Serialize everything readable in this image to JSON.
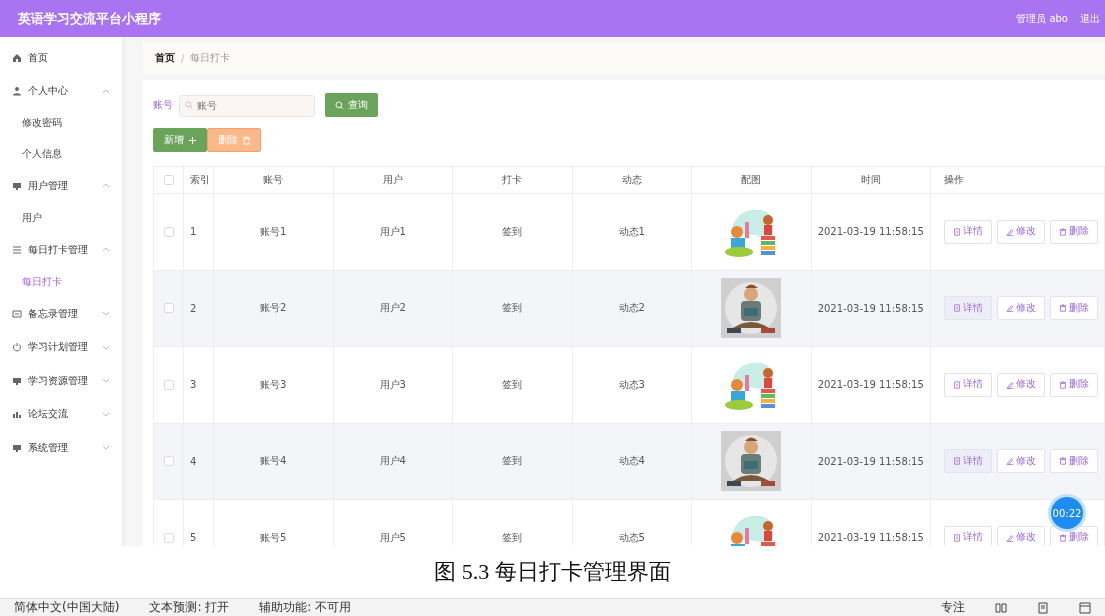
{
  "app": {
    "title": "英语学习交流平台小程序",
    "user": "管理员 abo",
    "logout": "退出"
  },
  "sidebar": {
    "items": [
      {
        "label": "首页"
      },
      {
        "label": "个人中心",
        "expanded": true,
        "children": [
          {
            "label": "修改密码",
            "selected": false
          },
          {
            "label": "个人信息",
            "selected": false
          }
        ]
      },
      {
        "label": "用户管理",
        "expanded": true,
        "children": [
          {
            "label": "用户",
            "selected": false
          }
        ]
      },
      {
        "label": "每日打卡管理",
        "expanded": true,
        "children": [
          {
            "label": "每日打卡",
            "selected": true
          }
        ]
      },
      {
        "label": "备忘录管理",
        "expanded": false
      },
      {
        "label": "学习计划管理",
        "expanded": false
      },
      {
        "label": "学习资源管理",
        "expanded": false
      },
      {
        "label": "论坛交流",
        "expanded": false
      },
      {
        "label": "系统管理",
        "expanded": false
      }
    ]
  },
  "breadcrumb": {
    "items": [
      "首页",
      "每日打卡"
    ],
    "separator": "/"
  },
  "search": {
    "label": "账号",
    "placeholder": "账号",
    "button": "查询"
  },
  "actions": {
    "add": "新增",
    "delete": "删除"
  },
  "table": {
    "select_all_checked": false,
    "columns": [
      "索引",
      "账号",
      "用户",
      "打卡",
      "动态",
      "配图",
      "时间",
      "操作"
    ],
    "rows": [
      {
        "checked": false,
        "index": "1",
        "account": "账号1",
        "user": "用户1",
        "checkin": "签到",
        "status": "动态1",
        "time": "2021-03-19 11:58:15",
        "buttons": [
          "详情",
          "修改",
          "删除"
        ],
        "detail_focused": false
      },
      {
        "checked": false,
        "index": "2",
        "account": "账号2",
        "user": "用户2",
        "checkin": "签到",
        "status": "动态2",
        "time": "2021-03-19 11:58:15",
        "buttons": [
          "详情",
          "修改",
          "删除"
        ],
        "detail_focused": true
      },
      {
        "checked": false,
        "index": "3",
        "account": "账号3",
        "user": "用户3",
        "checkin": "签到",
        "status": "动态3",
        "time": "2021-03-19 11:58:15",
        "buttons": [
          "详情",
          "修改",
          "删除"
        ],
        "detail_focused": false
      },
      {
        "checked": false,
        "index": "4",
        "account": "账号4",
        "user": "用户4",
        "checkin": "签到",
        "status": "动态4",
        "time": "2021-03-19 11:58:15",
        "buttons": [
          "详情",
          "修改",
          "删除"
        ],
        "detail_focused": true
      },
      {
        "checked": false,
        "index": "5",
        "account": "账号5",
        "user": "用户5",
        "checkin": "签到",
        "status": "动态5",
        "time": "2021-03-19 11:58:15",
        "buttons": [
          "详情",
          "修改",
          "删除"
        ],
        "detail_focused": false
      }
    ]
  },
  "timer": "00:22",
  "caption": "图 5.3  每日打卡管理界面",
  "status_bar": {
    "items": [
      "简体中文(中国大陆)",
      "文本预测: 打开",
      "辅助功能: 不可用"
    ],
    "focus": "专注"
  }
}
